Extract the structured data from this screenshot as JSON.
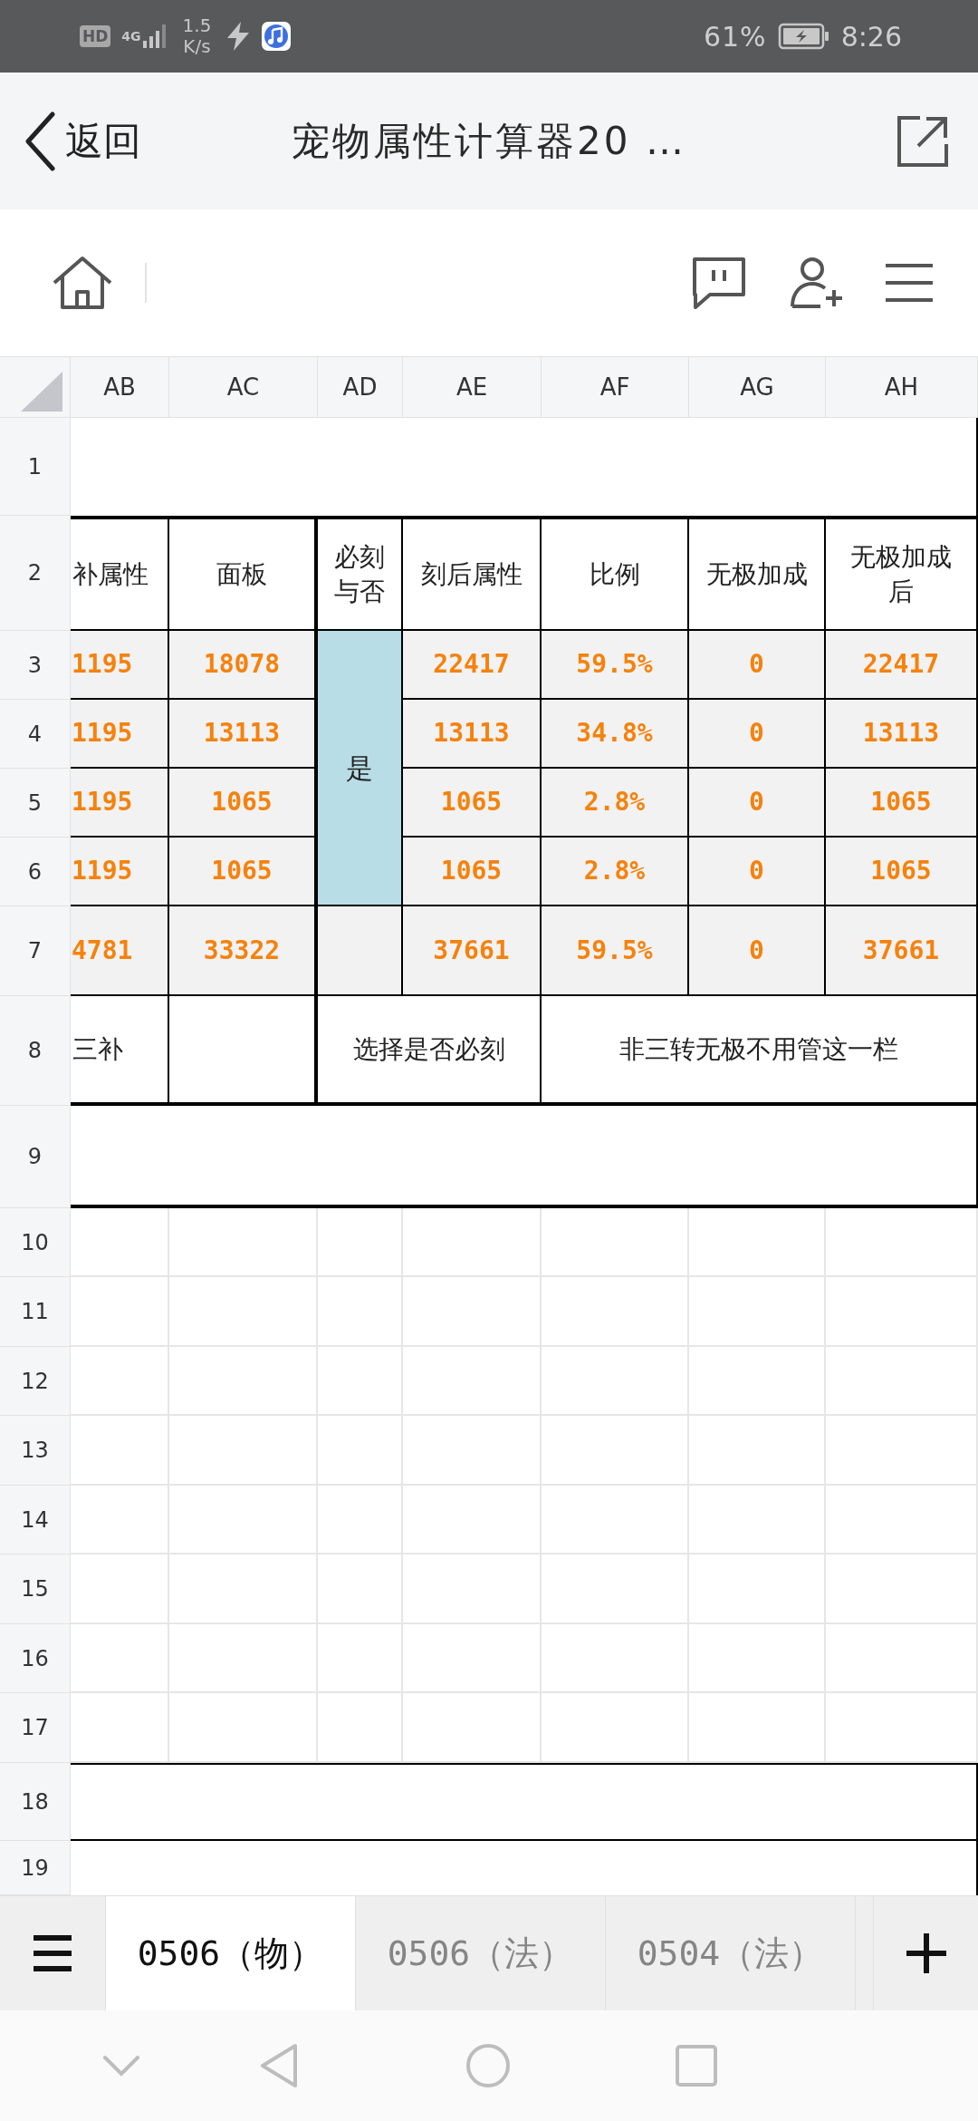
{
  "status_bar": {
    "hd": "HD",
    "network": "4G",
    "speed": "1.5",
    "speed_unit": "K/s",
    "battery": "61%",
    "time": "8:26"
  },
  "header": {
    "back_label": "返回",
    "title": "宠物属性计算器20 …"
  },
  "sheet": {
    "columns": [
      "AB",
      "AC",
      "AD",
      "AE",
      "AF",
      "AG",
      "AH"
    ],
    "merged_cell": "是",
    "rows": [
      {
        "number": "1",
        "kind": "band"
      },
      {
        "number": "2",
        "kind": "header",
        "cells": [
          "补属性",
          "面板",
          "必刻与否",
          "刻后属性",
          "比例",
          "无极加成",
          "无极加成后"
        ]
      },
      {
        "number": "3",
        "kind": "data",
        "cells": [
          "1195",
          "18078",
          "22417",
          "59.5%",
          "0",
          "22417"
        ]
      },
      {
        "number": "4",
        "kind": "data",
        "cells": [
          "1195",
          "13113",
          "13113",
          "34.8%",
          "0",
          "13113"
        ]
      },
      {
        "number": "5",
        "kind": "data",
        "cells": [
          "1195",
          "1065",
          "1065",
          "2.8%",
          "0",
          "1065"
        ]
      },
      {
        "number": "6",
        "kind": "data",
        "cells": [
          "1195",
          "1065",
          "1065",
          "2.8%",
          "0",
          "1065"
        ]
      },
      {
        "number": "7",
        "kind": "total",
        "cells": [
          "4781",
          "33322",
          "37661",
          "59.5%",
          "0",
          "37661"
        ]
      },
      {
        "number": "8",
        "kind": "note",
        "cells": [
          "三补",
          "选择是否必刻",
          "非三转无极不用管这一栏"
        ]
      },
      {
        "number": "9",
        "kind": "band"
      },
      {
        "number": "10",
        "kind": "grid"
      },
      {
        "number": "11",
        "kind": "grid"
      },
      {
        "number": "12",
        "kind": "grid"
      },
      {
        "number": "13",
        "kind": "grid"
      },
      {
        "number": "14",
        "kind": "grid"
      },
      {
        "number": "15",
        "kind": "grid"
      },
      {
        "number": "16",
        "kind": "grid"
      },
      {
        "number": "17",
        "kind": "grid"
      },
      {
        "number": "18",
        "kind": "band"
      },
      {
        "number": "19",
        "kind": "band"
      }
    ]
  },
  "sheet_tabs": [
    {
      "label": "0506（物）",
      "selected": true
    },
    {
      "label": "0506（法）",
      "selected": false
    },
    {
      "label": "0504（法）",
      "selected": false
    }
  ]
}
